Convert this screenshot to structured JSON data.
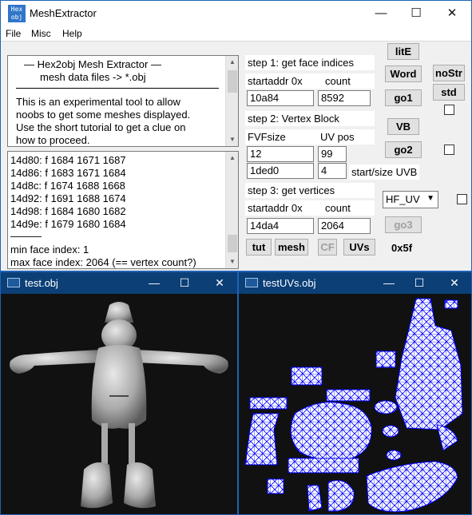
{
  "main_window": {
    "title": "MeshExtractor",
    "icon_text_1": "Hex",
    "icon_text_2": "obj",
    "controls": {
      "minimize": "—",
      "maximize": "☐",
      "close": "✕"
    },
    "menu": [
      "File",
      "Misc",
      "Help"
    ]
  },
  "info_box": {
    "line1": "—   Hex2obj Mesh Extractor   —",
    "line2": "mesh data files -> *.obj",
    "body": [
      "This is an experimental tool to allow",
      "noobs to get some meshes displayed.",
      "Use the short tutorial to get a clue on",
      "how to proceed."
    ]
  },
  "log_box": {
    "faces": [
      "14d80: f  1684 1671 1687",
      "14d86: f  1683 1671 1684",
      "14d8c: f  1674 1688 1668",
      "14d92: f  1691 1688 1674",
      "14d98: f  1684 1680 1682",
      "14d9e: f  1679 1680 1684"
    ],
    "separator": "———",
    "min_face": "min face index: 1",
    "max_face": "max face index: 2064 (== vertex count?)"
  },
  "step1": {
    "title": "step 1: get face indices",
    "startaddr_label": "startaddr 0x",
    "count_label": "count",
    "startaddr": "10a84",
    "count": "8592"
  },
  "step2": {
    "title": "step 2: Vertex Block",
    "fvf_label": "FVFsize",
    "uvpos_label": "UV pos",
    "fvf": "12",
    "uvpos": "99",
    "uvb_start": "1ded0",
    "uvb_size": "4",
    "uvb_label": "start/size UVB"
  },
  "step3": {
    "title": "step 3: get vertices",
    "startaddr_label": "startaddr 0x",
    "count_label": "count",
    "startaddr": "14da4",
    "count": "2064"
  },
  "buttons": {
    "lite": "litE",
    "word": "Word",
    "go1": "go1",
    "nostr": "noStr",
    "std": "std",
    "vb": "VB",
    "go2": "go2",
    "go3": "go3",
    "tut": "tut",
    "mesh": "mesh",
    "cf": "CF",
    "uvs": "UVs"
  },
  "combo_value": "HF_UV",
  "hex_readout": "0x5f",
  "test_window": {
    "title": "test.obj"
  },
  "uv_window": {
    "title": "testUVs.obj"
  },
  "colors": {
    "uv_line": "#0000ff",
    "uv_bg": "#ffffff",
    "canvas": "#111111"
  }
}
